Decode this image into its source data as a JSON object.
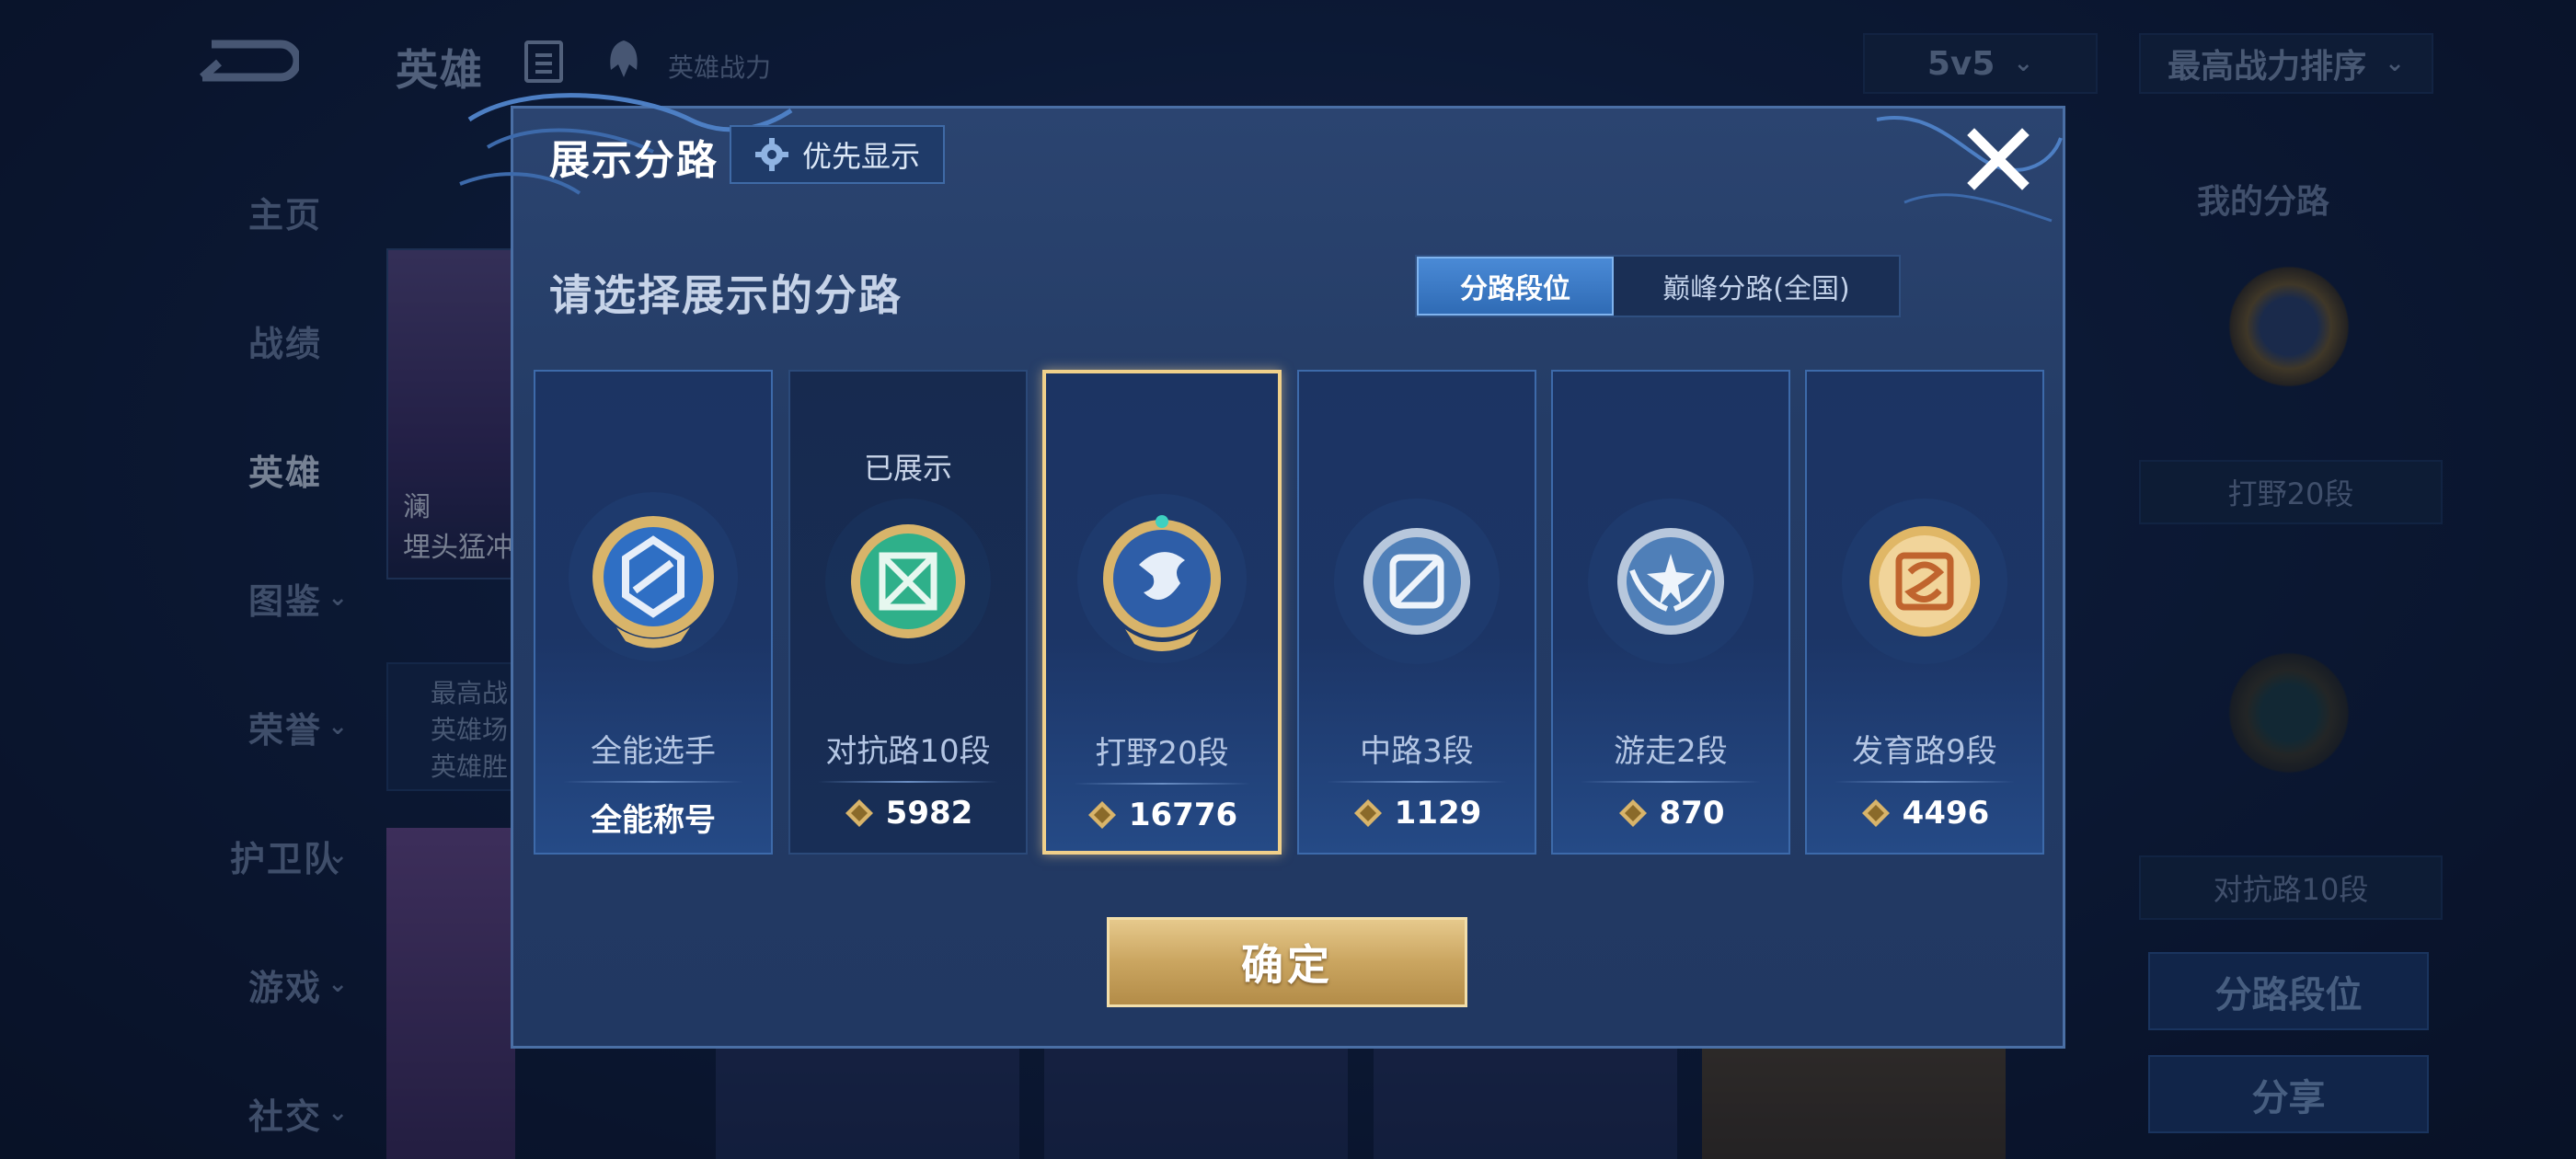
{
  "background": {
    "title": "英雄",
    "power_label": "英雄战力",
    "mode_select": "5v5",
    "sort_select": "最高战力排序",
    "nav": [
      {
        "label": "主页",
        "arrow": false,
        "active": false
      },
      {
        "label": "战绩",
        "arrow": false,
        "active": false
      },
      {
        "label": "英雄",
        "arrow": false,
        "active": true
      },
      {
        "label": "图鉴",
        "arrow": true,
        "active": false
      },
      {
        "label": "荣誉",
        "arrow": true,
        "active": false
      },
      {
        "label": "护卫队",
        "arrow": true,
        "active": false
      },
      {
        "label": "游戏",
        "arrow": true,
        "active": false
      },
      {
        "label": "社交",
        "arrow": true,
        "active": false
      }
    ],
    "hero_card": {
      "name_line1": "澜",
      "name_line2": "埋头猛冲"
    },
    "hero_stats": [
      "最高战",
      "英雄场",
      "英雄胜"
    ],
    "right_panel": {
      "my_lanes_title": "我的分路",
      "lane1_label": "打野20段",
      "lane2_label": "对抗路10段",
      "btn_lane_rank": "分路段位",
      "btn_share": "分享"
    }
  },
  "modal": {
    "title": "展示分路",
    "priority_label": "优先显示",
    "subtitle": "请选择展示的分路",
    "tabs": {
      "active": "分路段位",
      "inactive": "巅峰分路(全国)"
    },
    "cards": [
      {
        "name": "全能选手",
        "shown": "",
        "title": "全能称号",
        "score": "",
        "emblem": "all-rounder",
        "state": "normal"
      },
      {
        "name": "对抗路10段",
        "shown": "已展示",
        "title": "",
        "score": "5982",
        "emblem": "clash-lane",
        "state": "dark"
      },
      {
        "name": "打野20段",
        "shown": "",
        "title": "",
        "score": "16776",
        "emblem": "jungle",
        "state": "selected"
      },
      {
        "name": "中路3段",
        "shown": "",
        "title": "",
        "score": "1129",
        "emblem": "mid-lane",
        "state": "normal"
      },
      {
        "name": "游走2段",
        "shown": "",
        "title": "",
        "score": "870",
        "emblem": "roam",
        "state": "normal"
      },
      {
        "name": "发育路9段",
        "shown": "",
        "title": "",
        "score": "4496",
        "emblem": "farm-lane",
        "state": "normal"
      }
    ],
    "confirm_label": "确定"
  },
  "colors": {
    "gold": "#d8b46a",
    "selected_border": "#f0d08a",
    "accent_blue": "#3a78c4"
  }
}
